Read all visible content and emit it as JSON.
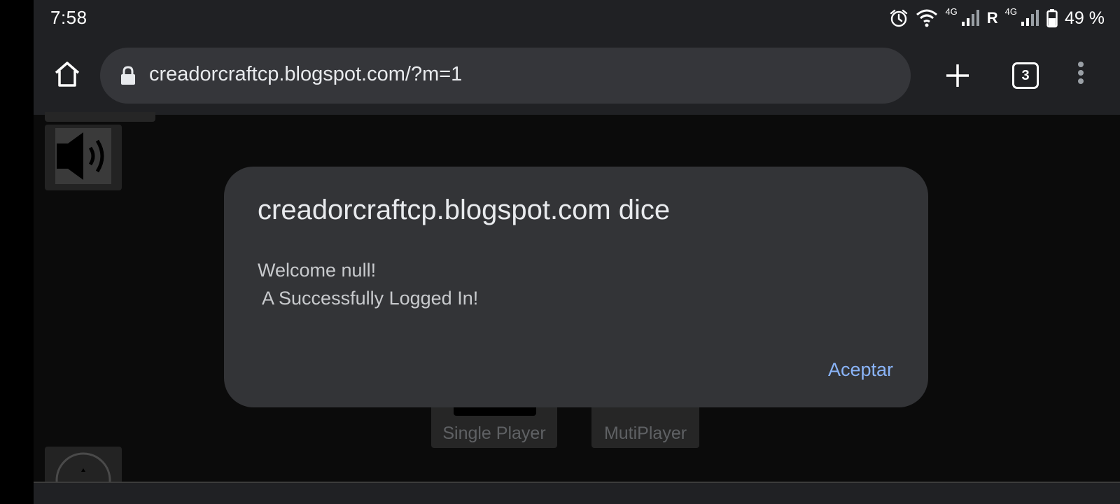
{
  "status_bar": {
    "time": "7:58",
    "network_1": "4G",
    "roaming": "R",
    "network_2": "4G",
    "battery": "49 %",
    "icons": [
      "alarm-icon",
      "wifi-icon",
      "signal-icon",
      "battery-icon"
    ]
  },
  "toolbar": {
    "url": "creadorcraftcp.blogspot.com/?m=1",
    "tab_count": "3",
    "icons": [
      "home-icon",
      "lock-icon",
      "plus-icon",
      "more-vert-icon"
    ]
  },
  "page": {
    "tiles": [
      {
        "label": "Single Player"
      },
      {
        "label": "MutiPlayer"
      }
    ]
  },
  "dialog": {
    "title": "creadorcraftcp.blogspot.com dice",
    "message": "Welcome null!\n A Successfully Logged In!",
    "button": "Aceptar"
  },
  "colors": {
    "toolbar_bg": "#202124",
    "url_bar_bg": "#35363a",
    "dialog_bg": "#333437",
    "accent": "#8ab4f8",
    "page_bg": "#0b0b0b"
  }
}
